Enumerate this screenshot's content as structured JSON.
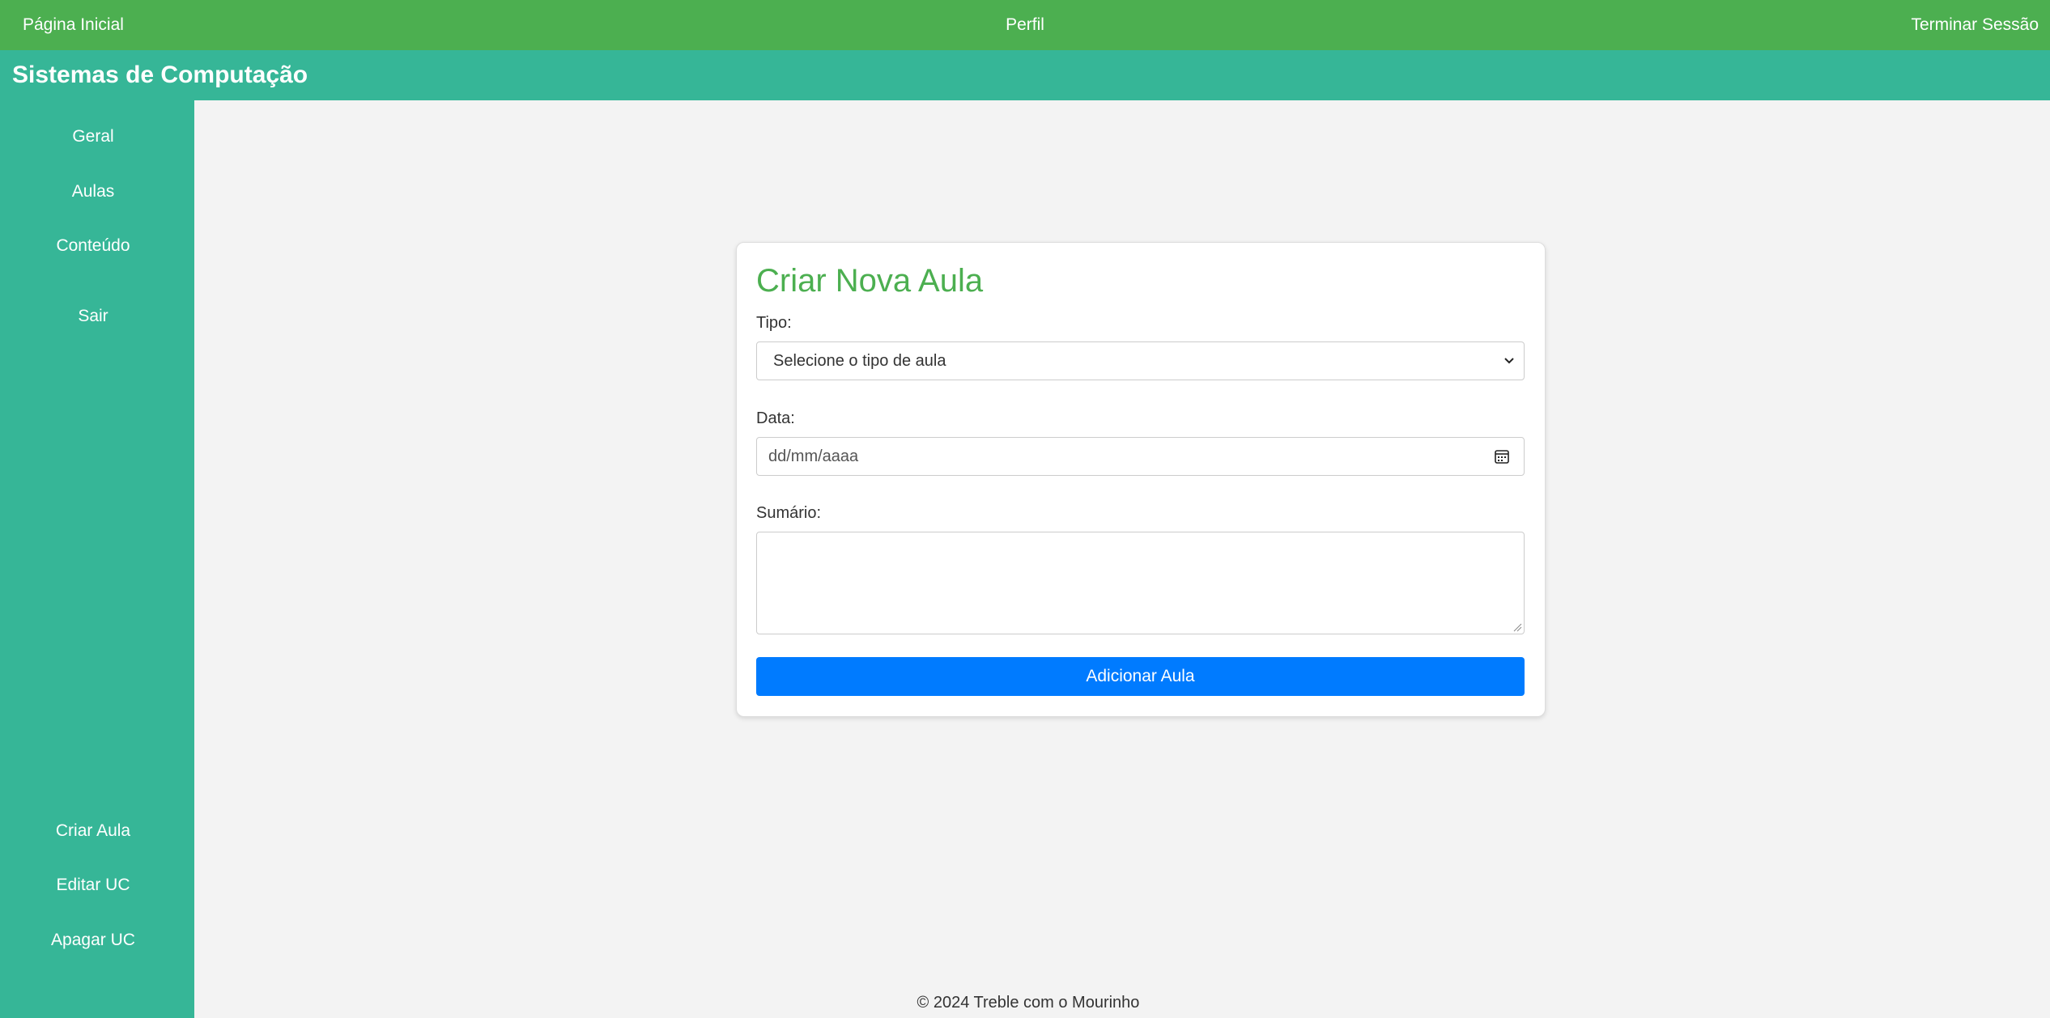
{
  "topnav": {
    "home": "Página Inicial",
    "profile": "Perfil",
    "logout": "Terminar Sessão"
  },
  "brand": {
    "title": "Sistemas de Computação"
  },
  "sidebar": {
    "items": [
      {
        "label": "Geral"
      },
      {
        "label": "Aulas"
      },
      {
        "label": "Conteúdo"
      },
      {
        "label": "Sair"
      }
    ],
    "bottom_items": [
      {
        "label": "Criar Aula"
      },
      {
        "label": "Editar UC"
      },
      {
        "label": "Apagar UC"
      }
    ]
  },
  "form": {
    "title": "Criar Nova Aula",
    "type_label": "Tipo:",
    "type_selected": "Selecione o tipo de aula",
    "date_label": "Data:",
    "date_placeholder": "dd/mm/aaaa",
    "summary_label": "Sumário:",
    "summary_value": "",
    "submit": "Adicionar Aula"
  },
  "footer": {
    "text": "© 2024 Treble com o Mourinho"
  },
  "colors": {
    "topbar": "#4caf50",
    "brandbar": "#36b697",
    "sidebar": "#36b697",
    "title": "#4caf50",
    "button": "#007bff"
  }
}
